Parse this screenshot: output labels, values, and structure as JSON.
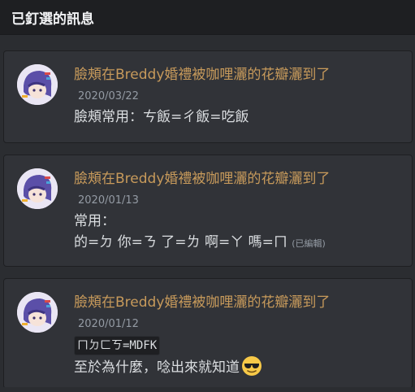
{
  "header": {
    "title": "已釘選的訊息"
  },
  "messages": [
    {
      "author": "臉頰在Breddy婚禮被咖哩灑的花瓣灑到了",
      "date": "2020/03/22",
      "line1": "臉頰常用：ㄘ飯=ㄔ飯=吃飯"
    },
    {
      "author": "臉頰在Breddy婚禮被咖哩灑的花瓣灑到了",
      "date": "2020/01/13",
      "line1": "常用：",
      "line2": "的=ㄉ 你=ㄋ 了=ㄌ 啊=ㄚ 嗎=ㄇ",
      "edited": "(已編輯)"
    },
    {
      "author": "臉頰在Breddy婚禮被咖哩灑的花瓣灑到了",
      "date": "2020/01/12",
      "code": "ㄇㄉㄈㄎ=MDFK",
      "line2": "至於為什麼，唸出來就知道"
    }
  ],
  "icons": {
    "avatar": "user-avatar-icon",
    "emoji": "sunglasses-emoji-icon"
  },
  "colors": {
    "background": "#2b2d31",
    "card": "#313338",
    "author": "#c79a5b",
    "text": "#dbdee1",
    "muted": "#949ba4"
  }
}
